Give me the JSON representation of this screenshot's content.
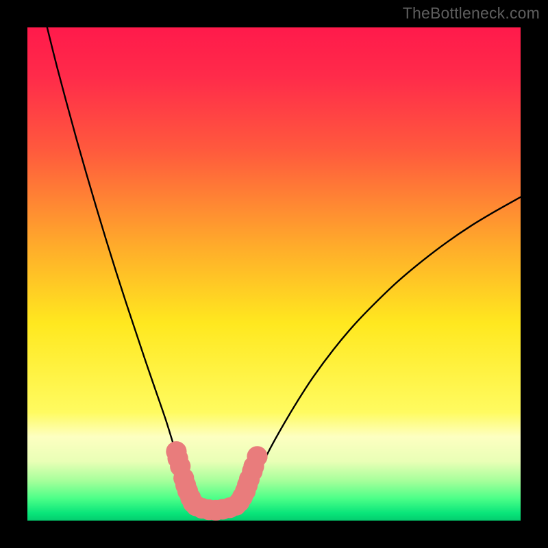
{
  "watermark": "TheBottleneck.com",
  "chart_data": {
    "type": "line",
    "title": "",
    "xlabel": "",
    "ylabel": "",
    "xlim": [
      0,
      100
    ],
    "ylim": [
      0,
      100
    ],
    "background_gradient": {
      "stops": [
        {
          "offset": 0.0,
          "color": "#ff1a4b"
        },
        {
          "offset": 0.1,
          "color": "#ff2b4a"
        },
        {
          "offset": 0.25,
          "color": "#ff5a3d"
        },
        {
          "offset": 0.45,
          "color": "#ffae2a"
        },
        {
          "offset": 0.6,
          "color": "#ffe81f"
        },
        {
          "offset": 0.78,
          "color": "#fffb60"
        },
        {
          "offset": 0.83,
          "color": "#fdffc1"
        },
        {
          "offset": 0.88,
          "color": "#e9ffb6"
        },
        {
          "offset": 0.92,
          "color": "#a4ff9a"
        },
        {
          "offset": 0.955,
          "color": "#4cff88"
        },
        {
          "offset": 0.985,
          "color": "#09e57a"
        },
        {
          "offset": 1.0,
          "color": "#04cd6e"
        }
      ]
    },
    "series": [
      {
        "name": "left-curve",
        "x": [
          4,
          6,
          8,
          10,
          12,
          14,
          16,
          18,
          20,
          22,
          24,
          26,
          28,
          29.5,
          31,
          32.5,
          33.5
        ],
        "y": [
          100,
          92,
          84.5,
          77.2,
          70.2,
          63.4,
          56.8,
          50.4,
          44.2,
          38.2,
          32.2,
          26.4,
          20.6,
          15.8,
          11,
          6.5,
          3.5
        ]
      },
      {
        "name": "right-curve",
        "x": [
          43.5,
          45,
          47,
          49,
          52,
          55,
          58,
          62,
          66,
          70,
          75,
          80,
          85,
          90,
          95,
          100
        ],
        "y": [
          3.5,
          6.0,
          10.0,
          14.2,
          19.6,
          24.6,
          29.2,
          34.6,
          39.4,
          43.6,
          48.4,
          52.6,
          56.4,
          59.8,
          62.8,
          65.6
        ]
      },
      {
        "name": "valley-floor",
        "x": [
          33.5,
          35,
          37,
          39,
          41,
          43.5
        ],
        "y": [
          3.5,
          2.6,
          2.2,
          2.2,
          2.6,
          3.5
        ]
      }
    ],
    "markers": {
      "name": "salmon-dots",
      "color": "#e97c7c",
      "radius": 2.1,
      "points": [
        {
          "x": 30.2,
          "y": 14.0
        },
        {
          "x": 30.5,
          "y": 12.6
        },
        {
          "x": 31.0,
          "y": 11.0
        },
        {
          "x": 31.7,
          "y": 8.6
        },
        {
          "x": 32.1,
          "y": 7.2
        },
        {
          "x": 32.5,
          "y": 6.0
        },
        {
          "x": 33.1,
          "y": 4.6
        },
        {
          "x": 33.6,
          "y": 3.6
        },
        {
          "x": 34.2,
          "y": 3.0
        },
        {
          "x": 35.4,
          "y": 2.5
        },
        {
          "x": 36.8,
          "y": 2.2
        },
        {
          "x": 38.2,
          "y": 2.1
        },
        {
          "x": 39.6,
          "y": 2.3
        },
        {
          "x": 41.0,
          "y": 2.6
        },
        {
          "x": 42.3,
          "y": 3.1
        },
        {
          "x": 43.0,
          "y": 3.8
        },
        {
          "x": 43.6,
          "y": 4.8
        },
        {
          "x": 44.2,
          "y": 6.0
        },
        {
          "x": 44.6,
          "y": 7.2
        },
        {
          "x": 45.0,
          "y": 8.4
        },
        {
          "x": 45.6,
          "y": 10.0
        },
        {
          "x": 45.9,
          "y": 11.0
        },
        {
          "x": 46.6,
          "y": 13.0
        }
      ]
    }
  }
}
